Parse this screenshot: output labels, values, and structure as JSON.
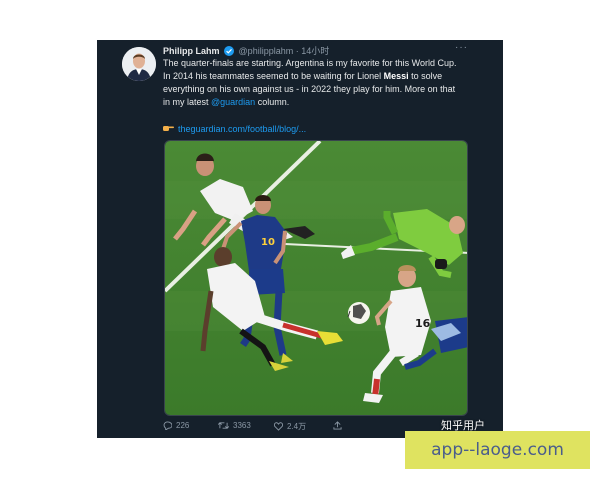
{
  "tweet": {
    "author_name": "Philipp Lahm",
    "handle": "@philipplahm",
    "time": "14小时",
    "text_1": "The quarter-finals are starting. Argentina is my favorite for this World Cup. In 2014 his teammates seemed to be waiting for Lionel ",
    "text_bold": "Messi",
    "text_2": " to solve everything on his own against us - in 2022 they play for him. More on that in my latest ",
    "mention": "@guardian",
    "text_3": " column.",
    "link": "theguardian.com/football/blog/...",
    "more_label": "···"
  },
  "actions": {
    "replies": "226",
    "retweets": "3363",
    "likes": "2.4万"
  },
  "media": {
    "jersey_16": "16",
    "jersey_10": "10"
  },
  "overlay_text": "知乎用户",
  "watermark": "app--laoge.com"
}
